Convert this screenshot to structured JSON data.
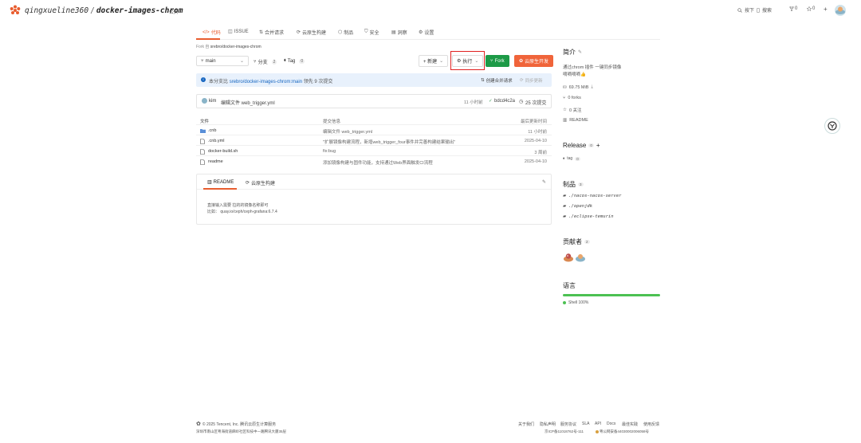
{
  "header": {
    "owner": "qingxueline360",
    "separator": "/",
    "repo": "docker-images-chrom",
    "visibility": "公开",
    "search_shortcut": "按下",
    "search_label": "搜索",
    "fork_count": "0",
    "star_count": "0",
    "add_label": "+"
  },
  "tabs": [
    {
      "label": "代码",
      "icon": "code-icon"
    },
    {
      "label": "ISSUE",
      "icon": "issue-icon"
    },
    {
      "label": "合并请求",
      "icon": "merge-request-icon"
    },
    {
      "label": "云原生构建",
      "icon": "cloud-build-icon"
    },
    {
      "label": "制品",
      "icon": "package-icon"
    },
    {
      "label": "安全",
      "icon": "shield-icon"
    },
    {
      "label": "洞察",
      "icon": "insight-icon"
    },
    {
      "label": "设置",
      "icon": "gear-icon"
    }
  ],
  "fork_info": {
    "prefix": "Fork 自",
    "source": "srebro/docker-images-chrom"
  },
  "toolbar": {
    "branch": "main",
    "branches_label": "分支",
    "branches_count": "2",
    "tags_label": "Tag",
    "tags_count": "0",
    "new_label": "+ 新建",
    "run_label": "执行",
    "fork_label": "Fork",
    "cloud_dev_label": "云原生开发"
  },
  "banner": {
    "prefix": "本分支比",
    "link": "srebro/docker-images-chrom:main",
    "suffix": "领先 9 次提交",
    "create_mr": "创建合并请求",
    "sync": "同步更新"
  },
  "last_commit": {
    "author": "kim",
    "message": "编辑文件 web_trigger.yml",
    "time": "11 小时前",
    "hash": "bdcd4c2a",
    "commit_count": "25 次提交"
  },
  "file_table": {
    "headers": [
      "文件",
      "提交信息",
      "最后更新时间"
    ],
    "rows": [
      {
        "name": ".cnb",
        "type": "folder",
        "message": "编辑文件 web_trigger.yml",
        "time": "11 小时前"
      },
      {
        "name": ".cnb.yml",
        "type": "file",
        "message": "\"扩展镜像构建流程，新增web_trigger_four事件并完善构建结果输出\"",
        "time": "2025-04-10"
      },
      {
        "name": "docker-build.sh",
        "type": "file",
        "message": "fix:bug",
        "time": "3 周前"
      },
      {
        "name": "readme",
        "type": "file",
        "message": "添加镜像构建与固件功能，支持通过Web界面触发CI流程",
        "time": "2025-04-10"
      }
    ]
  },
  "readme": {
    "tab_readme": "README",
    "tab_build": "云原生构建",
    "lines": [
      "直接输入需要 拉的的镜像名称即可",
      "比如：  quay.io/ceph/ceph-grafana:6.7.4"
    ]
  },
  "sidebar": {
    "about_title": "简介",
    "description_line1": "通过chrom 插件 一键同步镜像",
    "description_line2": "嘀嘀嘀嘀👍",
    "size": "69.75 MiB",
    "forks": "0 forks",
    "stars": "0 关注",
    "readme": "README",
    "release_title": "Release",
    "release_count": "0",
    "tag_label": "tag",
    "tag_count": "0",
    "packages_title": "制品",
    "packages_count": "3",
    "packages": [
      "./nacos-nacos-server",
      "./openjdk",
      "./eclipse-temurin"
    ],
    "contributors_title": "贡献者",
    "contributors_count": "2",
    "languages_title": "语言",
    "language": "Shell 100%"
  },
  "footer": {
    "copyright": "© 2025 Tencent, Inc. 腾讯云原生计算服务",
    "address": "深圳市南山区粤海街道麻岭社区科技中一路腾讯大厦35层",
    "links": [
      "关于我们",
      "隐私声明",
      "服务协议",
      "SLA",
      "API",
      "Docs",
      "最佳实践",
      "使用反馈"
    ],
    "icp": "京ICP备11018762号-111",
    "police": "粤公网安备44030002006058号"
  },
  "colors": {
    "accent": "#e85d2f",
    "green": "#1d9a47",
    "orange": "#f0643a",
    "link": "#1565c0",
    "banner_bg": "#e8f1fc",
    "highlight_box": "#e02020"
  }
}
